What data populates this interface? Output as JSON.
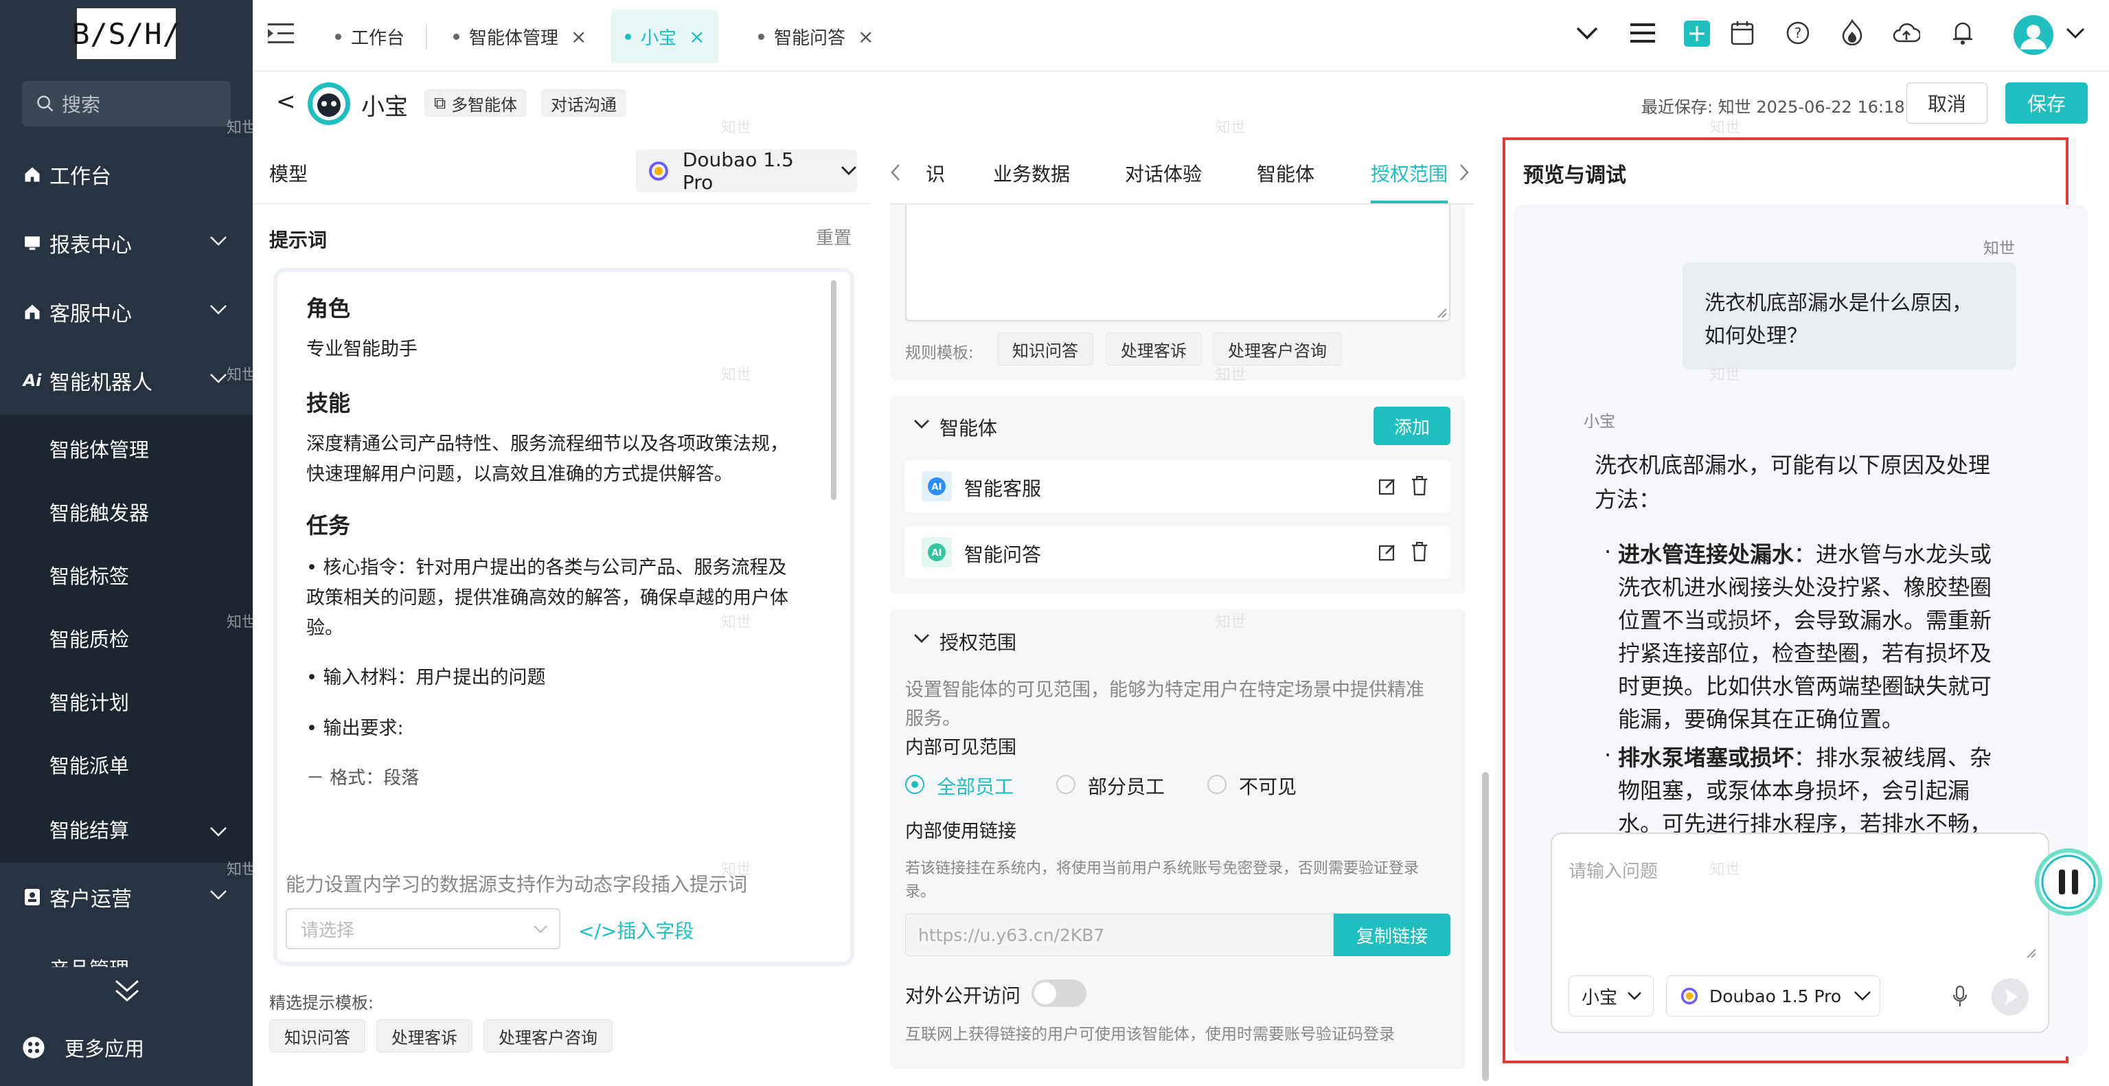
{
  "sidebar": {
    "logo_text": "B/S/H/",
    "search_placeholder": "搜索",
    "items": [
      {
        "label": "工作台"
      },
      {
        "label": "报表中心"
      },
      {
        "label": "客服中心"
      },
      {
        "label": "智能机器人"
      }
    ],
    "sub_items": [
      {
        "label": "智能体管理"
      },
      {
        "label": "智能触发器"
      },
      {
        "label": "智能标签"
      },
      {
        "label": "智能质检"
      },
      {
        "label": "智能计划"
      },
      {
        "label": "智能派单"
      },
      {
        "label": "智能结算"
      }
    ],
    "item_customer_ops": "客户运营",
    "item_partial": "产品管理",
    "more_apps": "更多应用"
  },
  "tabs": [
    {
      "label": "工作台",
      "closable": false
    },
    {
      "label": "智能体管理",
      "closable": true
    },
    {
      "label": "小宝",
      "closable": true,
      "active": true
    },
    {
      "label": "智能问答",
      "closable": true
    }
  ],
  "header": {
    "back": "<",
    "agent_name": "小宝",
    "badge_multi": "多智能体",
    "badge_chat": "对话沟通",
    "last_saved": "最近保存: 知世 2025-06-22 16:18",
    "cancel_label": "取消",
    "save_label": "保存"
  },
  "left": {
    "model_label": "模型",
    "model_value": "Doubao 1.5 Pro",
    "prompt_label": "提示词",
    "reset_label": "重置",
    "role_heading": "角色",
    "role_text": "专业智能助手",
    "skill_heading": "技能",
    "skill_text_1": "深度精通公司产品特性、服务流程细节以及各项政策法规，",
    "skill_text_2": "快速理解用户问题，以高效且准确的方式提供解答。",
    "task_heading": "任务",
    "task_1a": "• 核心指令：针对用户提出的各类与公司产品、服务流程及",
    "task_1b": "政策相关的问题，提供准确高效的解答，确保卓越的用户体",
    "task_1c": "验。",
    "task_2": "• 输入材料：用户提出的问题",
    "task_3": "• 输出要求:",
    "task_4": "－ 格式：段落",
    "hint": "能力设置内学习的数据源支持作为动态字段插入提示词",
    "select_placeholder": "请选择",
    "insert_field": "</>插入字段",
    "templates_label": "精选提示模板:",
    "templates": [
      "知识问答",
      "处理客诉",
      "处理客户咨询"
    ]
  },
  "middle": {
    "tabs": [
      "识",
      "业务数据",
      "对话体验",
      "智能体",
      "授权范围"
    ],
    "rule_templates_label": "规则模板:",
    "rule_templates": [
      "知识问答",
      "处理客诉",
      "处理客户咨询"
    ],
    "agents_title": "智能体",
    "add_label": "添加",
    "agents": [
      {
        "name": "智能客服"
      },
      {
        "name": "智能问答"
      }
    ],
    "auth_title": "授权范围",
    "auth_desc_1": "设置智能体的可见范围，能够为特定用户在特定场景中提供精准",
    "auth_desc_2": "服务。",
    "internal_scope": "内部可见范围",
    "scope_options": [
      "全部员工",
      "部分员工",
      "不可见"
    ],
    "internal_link": "内部使用链接",
    "link_desc_1": "若该链接挂在系统内，将使用当前用户系统账号免密登录，否则需要验证登录",
    "link_desc_2": "录。",
    "link_value": "https://u.y63.cn/2KB7",
    "copy_link": "复制链接",
    "public_access": "对外公开访问",
    "public_desc": "互联网上获得链接的用户可使用该智能体，使用时需要账号验证码登录"
  },
  "preview": {
    "title": "预览与调试",
    "user_name": "知世",
    "user_msg_1": "洗衣机底部漏水是什么原因，",
    "user_msg_2": "如何处理？",
    "bot_name": "小宝",
    "bot_intro_1": "洗衣机底部漏水，可能有以下原因及处理",
    "bot_intro_2": "方法：",
    "b1_title": "进水管连接处漏水",
    "b1_l1": "：进水管与水龙头或",
    "b1_l2": "洗衣机进水阀接头处没拧紧、橡胶垫圈",
    "b1_l3": "位置不当或损坏，会导致漏水。需重新",
    "b1_l4": "拧紧连接部位，检查垫圈，若有损坏及",
    "b1_l5": "时更换。比如供水管两端垫圈缺失就可",
    "b1_l6": "能漏，要确保其在正确位置。",
    "b2_title": "排水泵堵塞或损坏",
    "b2_l1": "：排水泵被线屑、杂",
    "b2_l2": "物阻塞，或泵体本身损坏，会引起漏",
    "b2_l3": "水。可先进行排水程序，若排水不畅，",
    "input_placeholder": "请输入问题",
    "agent_select": "小宝",
    "model_select": "Doubao 1.5 Pro"
  },
  "watermark": "知世",
  "colors": {
    "accent": "#1fbfbf",
    "sidebar": "#273340",
    "highlight_border": "#e53935"
  }
}
